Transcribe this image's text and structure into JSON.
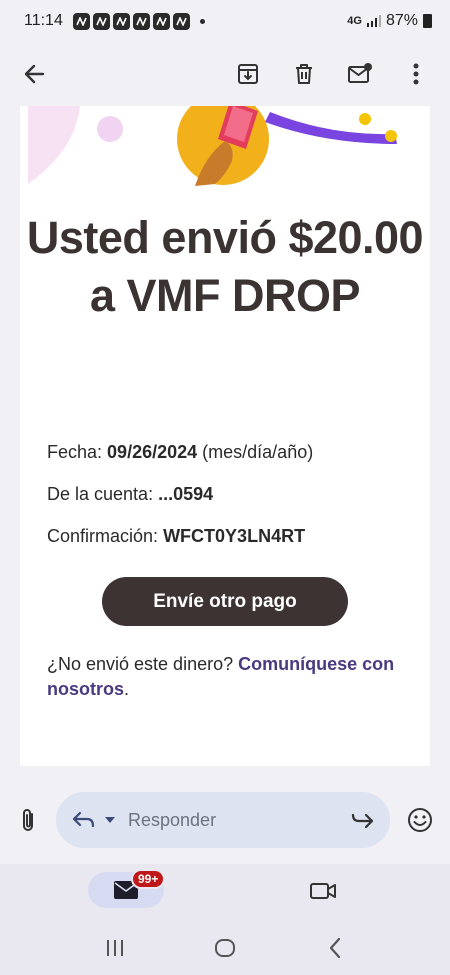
{
  "status_bar": {
    "time": "11:14",
    "network": "4G",
    "battery": "87%"
  },
  "toolbar": {
    "back_icon": "arrow-left-icon",
    "archive_icon": "archive-icon",
    "delete_icon": "trash-icon",
    "mark_unread_icon": "mark-unread-icon",
    "more_icon": "more-vertical-icon"
  },
  "email": {
    "headline": "Usted envió $20.00 a VMF DROP",
    "details": [
      {
        "label": "Fecha:",
        "value": "09/26/2024",
        "suffix": "(mes/día/año)"
      },
      {
        "label": "De la cuenta:",
        "value": "...0594",
        "suffix": ""
      },
      {
        "label": "Confirmación:",
        "value": "WFCT0Y3LN4RT",
        "suffix": ""
      }
    ],
    "cta_label": "Envíe otro pago",
    "footer_question": "¿No envió este dinero?",
    "footer_link": "Comuníquese con nosotros",
    "footer_period": "."
  },
  "reply_bar": {
    "placeholder": "Responder"
  },
  "bottom_nav": {
    "mail_badge": "99+"
  },
  "colors": {
    "cta": "#3d3332",
    "link": "#4b3a80",
    "headline": "#3b3332",
    "badge": "#c01818"
  }
}
